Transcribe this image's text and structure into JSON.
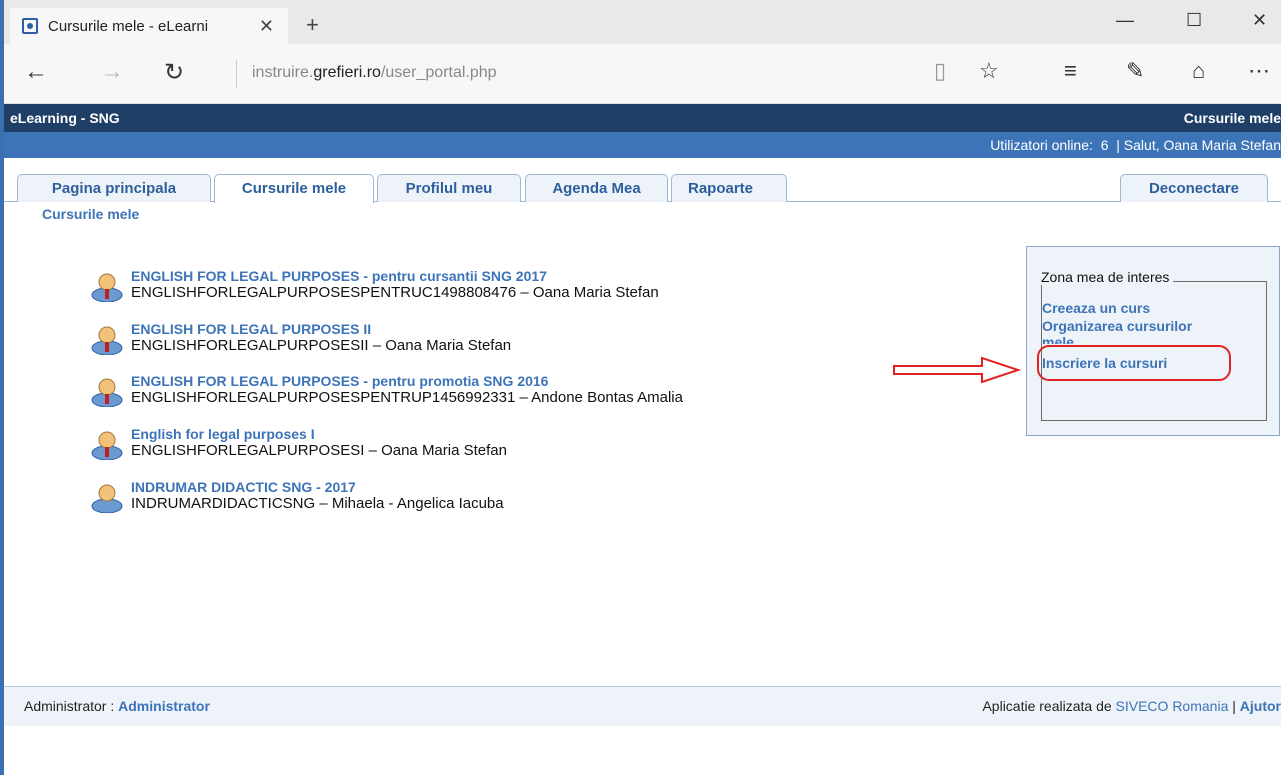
{
  "browser": {
    "tab_title": "Cursurile mele - eLearni",
    "tab_close": "✕",
    "new_tab": "+",
    "url_prefix": "instruire.",
    "url_domain": "grefieri.ro",
    "url_path": "/user_portal.php"
  },
  "site": {
    "app_name": "eLearning - SNG",
    "section_title": "Cursurile mele",
    "online_label": "Utilizatori online:",
    "online_count": "6",
    "greeting": "| Salut, Oana Maria Stefan"
  },
  "tabs": [
    {
      "label": "Pagina principala"
    },
    {
      "label": "Cursurile mele"
    },
    {
      "label": "Profilul meu"
    },
    {
      "label": "Agenda Mea"
    },
    {
      "label": "Rapoarte"
    }
  ],
  "logout_label": "Deconectare",
  "breadcrumb": "Cursurile mele",
  "courses": [
    {
      "title": "ENGLISH FOR LEGAL PURPOSES - pentru cursantii SNG 2017",
      "code_owner": "ENGLISHFORLEGALPURPOSESPENTRUC1498808476 – Oana Maria Stefan",
      "icon": "teacher-icon"
    },
    {
      "title": "ENGLISH FOR LEGAL PURPOSES II",
      "code_owner": "ENGLISHFORLEGALPURPOSESII – Oana Maria Stefan",
      "icon": "teacher-icon"
    },
    {
      "title": "ENGLISH FOR LEGAL PURPOSES - pentru promotia SNG 2016",
      "code_owner": "ENGLISHFORLEGALPURPOSESPENTRUP1456992331 – Andone Bontas Amalia",
      "icon": "teacher-icon"
    },
    {
      "title": "English for legal purposes I",
      "code_owner": "ENGLISHFORLEGALPURPOSESI – Oana Maria Stefan",
      "icon": "teacher-icon"
    },
    {
      "title": "INDRUMAR DIDACTIC SNG - 2017",
      "code_owner": "INDRUMARDIDACTICSNG – Mihaela - Angelica Iacuba",
      "icon": "student-icon"
    }
  ],
  "interest": {
    "legend": "Zona mea de interes",
    "links": [
      "Creeaza un curs",
      "Organizarea cursurilor",
      "mele",
      "Inscriere la cursuri"
    ]
  },
  "footer": {
    "admin_label": "Administrator :",
    "admin_name": "Administrator",
    "credit_label": "Aplicatie realizata de",
    "credit_company": "SIVECO Romania",
    "separator": "|",
    "help": "Ajutor"
  },
  "colors": {
    "header_dark": "#1f3f67",
    "header_blue": "#3d74b8",
    "link": "#3d74b8",
    "annotation": "#e22222"
  }
}
